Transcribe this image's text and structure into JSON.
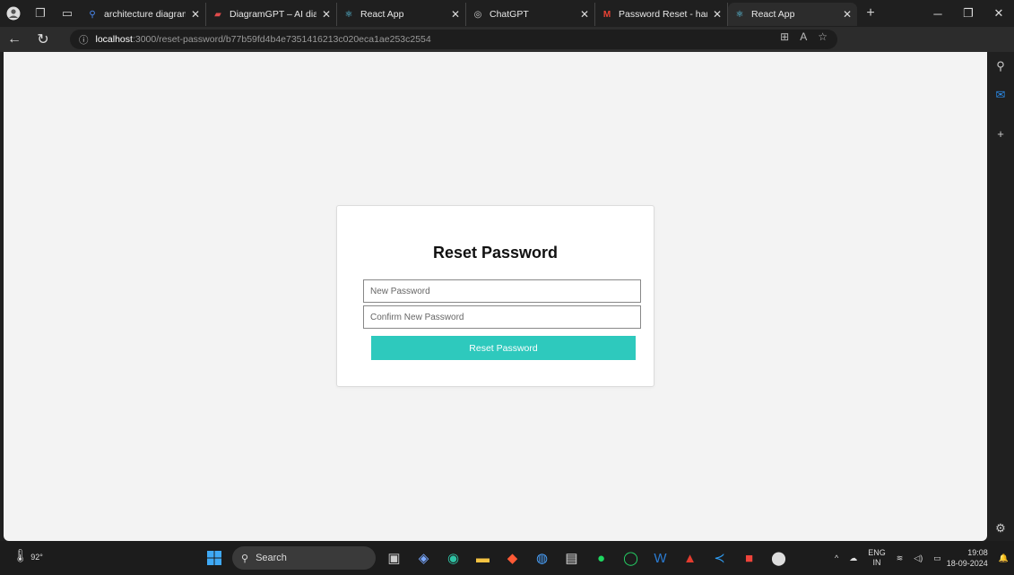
{
  "tabs": [
    {
      "title": "architecture diagram gene",
      "icon": "search-favicon",
      "color": "#4a8af4"
    },
    {
      "title": "DiagramGPT – AI diagram",
      "icon": "diagramgpt-favicon",
      "color": "#e04b4b"
    },
    {
      "title": "React App",
      "icon": "react-favicon",
      "color": "#61dafb"
    },
    {
      "title": "ChatGPT",
      "icon": "chatgpt-favicon",
      "color": "#cccccc"
    },
    {
      "title": "Password Reset - harinims",
      "icon": "gmail-favicon",
      "color": "#ea4335"
    },
    {
      "title": "React App",
      "icon": "react-favicon",
      "color": "#61dafb"
    }
  ],
  "address": {
    "host": "localhost",
    "path": ":3000/reset-password/b77b59fd4b4e7351416213c020eca1ae253c2554"
  },
  "form": {
    "title": "Reset Password",
    "new_password_placeholder": "New Password",
    "confirm_password_placeholder": "Confirm New Password",
    "submit_label": "Reset Password",
    "accent": "#2ec9bd"
  },
  "taskbar": {
    "weather": "92°",
    "search_label": "Search",
    "lang_top": "ENG",
    "lang_bottom": "IN",
    "time": "19:08",
    "date": "18-09-2024"
  }
}
